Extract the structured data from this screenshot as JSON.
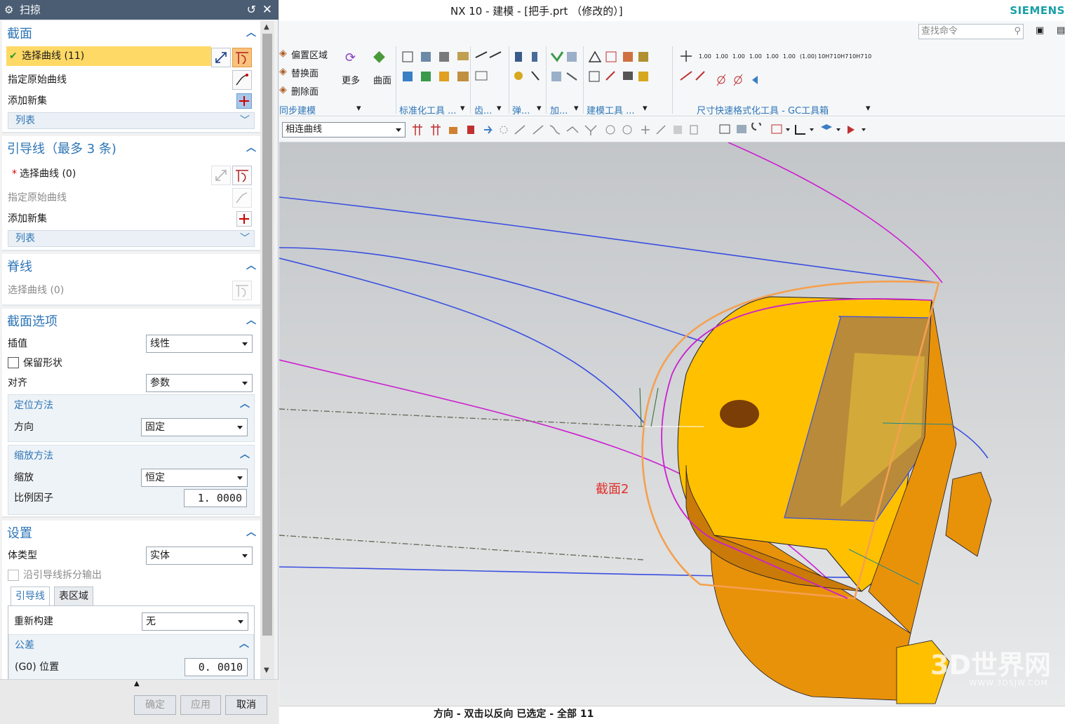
{
  "dialog": {
    "title": "扫掠",
    "section": {
      "title": "截面",
      "select_curve": "选择曲线 (11)",
      "specify_origin": "指定原始曲线",
      "add_new_set": "添加新集",
      "list": "列表"
    },
    "guide": {
      "title": "引导线（最多 3 条)",
      "select_curve": "选择曲线 (0)",
      "specify_origin": "指定原始曲线",
      "add_new_set": "添加新集",
      "list": "列表"
    },
    "spine": {
      "title": "脊线",
      "select_curve": "选择曲线 (0)"
    },
    "section_options": {
      "title": "截面选项",
      "interp_label": "插值",
      "interp_value": "线性",
      "keep_shape": "保留形状",
      "align_label": "对齐",
      "align_value": "参数",
      "orient": {
        "title": "定位方法",
        "dir_label": "方向",
        "dir_value": "固定"
      },
      "scale": {
        "title": "缩放方法",
        "scale_label": "缩放",
        "scale_value": "恒定",
        "factor_label": "比例因子",
        "factor_value": "1. 0000"
      }
    },
    "settings": {
      "title": "设置",
      "body_type_label": "体类型",
      "body_type_value": "实体",
      "split_output": "沿引导线拆分输出",
      "tabs": [
        "引导线",
        "表区域"
      ],
      "rebuild_label": "重新构建",
      "rebuild_value": "无",
      "tolerance": {
        "title": "公差",
        "g0_label": "(G0) 位置",
        "g0_value": "0. 0010"
      }
    },
    "buttons": {
      "ok": "确定",
      "apply": "应用",
      "cancel": "取消"
    }
  },
  "main": {
    "title": "NX 10 - 建模 - [把手.prt （修改的）]",
    "brand": "SIEMENS",
    "search_placeholder": "查找命令",
    "ribbon": {
      "sync_items": [
        "偏置区域",
        "替换面",
        "删除面"
      ],
      "more": "更多",
      "surface": "曲面",
      "groups": [
        "同步建模",
        "标准化工具 ...",
        "齿...",
        "弹...",
        "加...",
        "建模工具 ...",
        "尺寸快速格式化工具 - GC工具箱"
      ],
      "dim_labels": [
        "1.00",
        "1.00",
        "1.00",
        "1.00",
        "1.00",
        "1.00",
        "(1.00)",
        "10H7",
        "10H7",
        "10H7",
        "10"
      ]
    },
    "curve_rule": "相连曲线",
    "viewport_label": "截面2",
    "status": "方向 - 双击以反向 已选定 - 全部 11",
    "watermark": "3D世界网",
    "watermark_url": "WWW.3DSJW.COM"
  },
  "colors": {
    "title_bar": "#4a5d73",
    "selection": "#ffd966",
    "accent": "#2e75b6",
    "part_yellow": "#ffc000",
    "part_orange": "#e8920a",
    "curve_blue": "#3a4fe0",
    "curve_magenta": "#cc1fd1"
  }
}
